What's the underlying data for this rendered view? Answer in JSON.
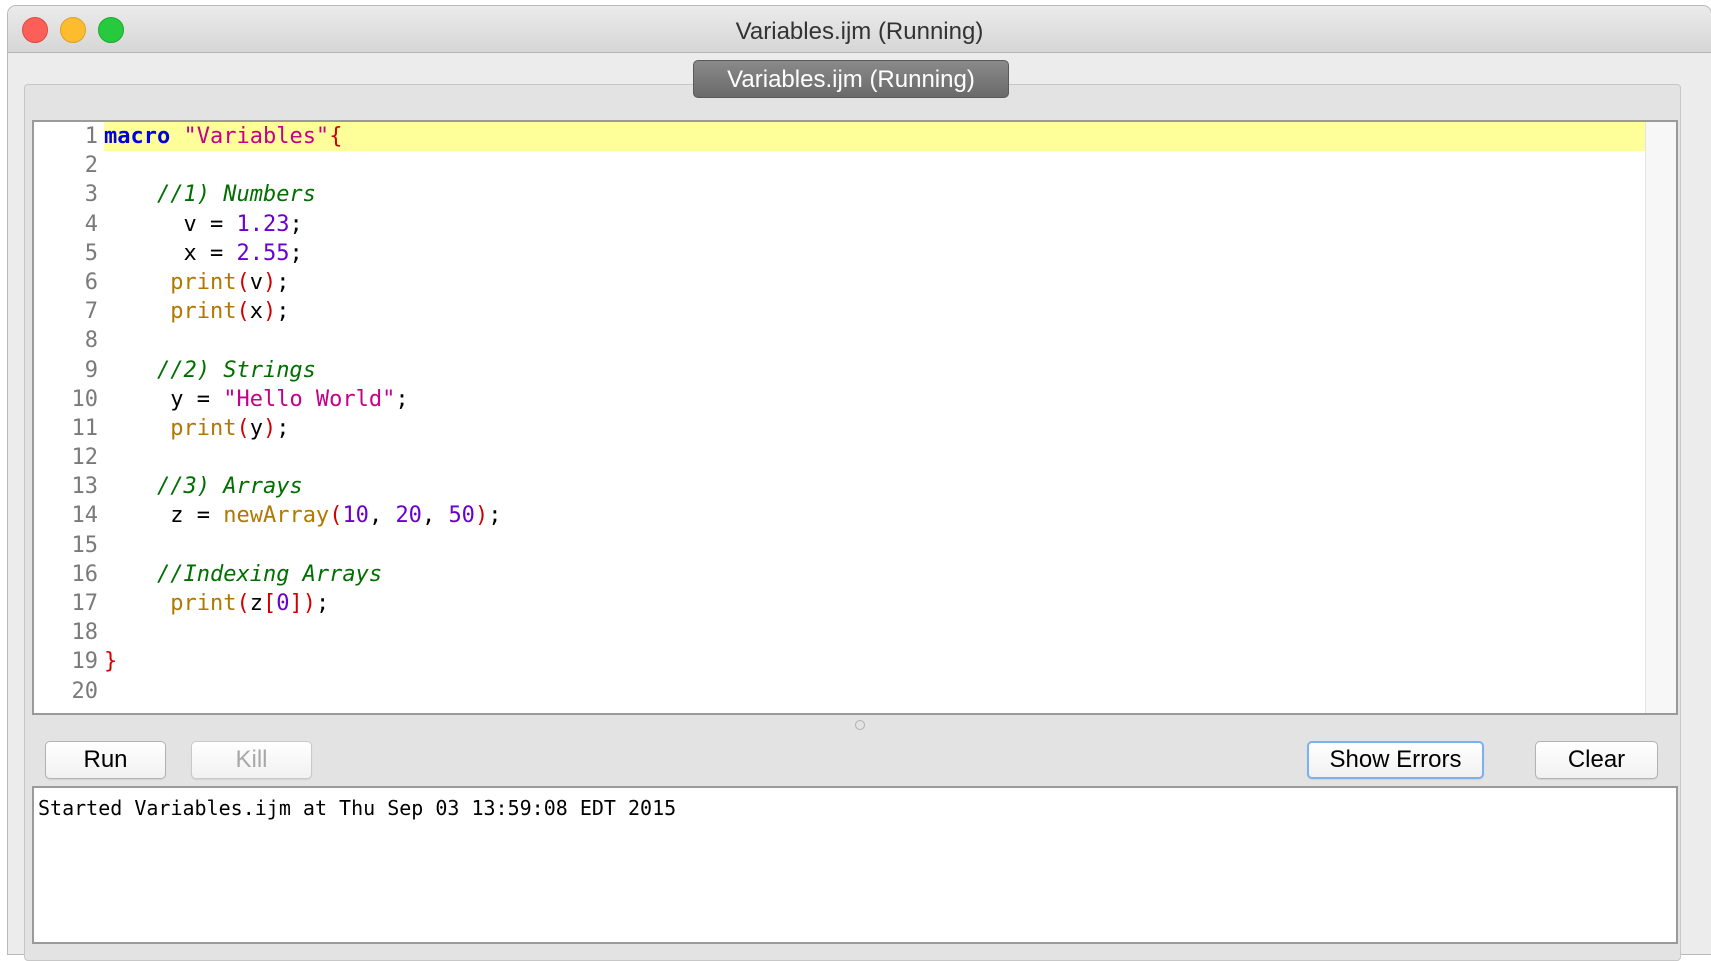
{
  "window": {
    "title": "Variables.ijm (Running)"
  },
  "tab": {
    "label": "Variables.ijm (Running)"
  },
  "editor": {
    "lines": [
      {
        "num": "1",
        "tokens": [
          [
            "kw",
            "macro"
          ],
          [
            "pl",
            " "
          ],
          [
            "str",
            "\"Variables\""
          ],
          [
            "brace",
            "{"
          ]
        ]
      },
      {
        "num": "2",
        "tokens": []
      },
      {
        "num": "3",
        "tokens": [
          [
            "pl",
            "    "
          ],
          [
            "com",
            "//1) Numbers"
          ]
        ]
      },
      {
        "num": "4",
        "tokens": [
          [
            "pl",
            "      v = "
          ],
          [
            "num",
            "1.23"
          ],
          [
            "pl",
            ";"
          ]
        ]
      },
      {
        "num": "5",
        "tokens": [
          [
            "pl",
            "      x = "
          ],
          [
            "num",
            "2.55"
          ],
          [
            "pl",
            ";"
          ]
        ]
      },
      {
        "num": "6",
        "tokens": [
          [
            "pl",
            "     "
          ],
          [
            "fn",
            "print"
          ],
          [
            "par",
            "("
          ],
          [
            "pl",
            "v"
          ],
          [
            "par",
            ")"
          ],
          [
            "pl",
            ";"
          ]
        ]
      },
      {
        "num": "7",
        "tokens": [
          [
            "pl",
            "     "
          ],
          [
            "fn",
            "print"
          ],
          [
            "par",
            "("
          ],
          [
            "pl",
            "x"
          ],
          [
            "par",
            ")"
          ],
          [
            "pl",
            ";"
          ]
        ]
      },
      {
        "num": "8",
        "tokens": []
      },
      {
        "num": "9",
        "tokens": [
          [
            "pl",
            "    "
          ],
          [
            "com",
            "//2) Strings"
          ]
        ]
      },
      {
        "num": "10",
        "tokens": [
          [
            "pl",
            "     y = "
          ],
          [
            "str",
            "\"Hello World\""
          ],
          [
            "pl",
            ";"
          ]
        ]
      },
      {
        "num": "11",
        "tokens": [
          [
            "pl",
            "     "
          ],
          [
            "fn",
            "print"
          ],
          [
            "par",
            "("
          ],
          [
            "pl",
            "y"
          ],
          [
            "par",
            ")"
          ],
          [
            "pl",
            ";"
          ]
        ]
      },
      {
        "num": "12",
        "tokens": []
      },
      {
        "num": "13",
        "tokens": [
          [
            "pl",
            "    "
          ],
          [
            "com",
            "//3) Arrays"
          ]
        ]
      },
      {
        "num": "14",
        "tokens": [
          [
            "pl",
            "     z = "
          ],
          [
            "fn",
            "newArray"
          ],
          [
            "par",
            "("
          ],
          [
            "num",
            "10"
          ],
          [
            "pl",
            ", "
          ],
          [
            "num",
            "20"
          ],
          [
            "pl",
            ", "
          ],
          [
            "num",
            "50"
          ],
          [
            "par",
            ")"
          ],
          [
            "pl",
            ";"
          ]
        ]
      },
      {
        "num": "15",
        "tokens": []
      },
      {
        "num": "16",
        "tokens": [
          [
            "pl",
            "    "
          ],
          [
            "com",
            "//Indexing Arrays"
          ]
        ]
      },
      {
        "num": "17",
        "tokens": [
          [
            "pl",
            "     "
          ],
          [
            "fn",
            "print"
          ],
          [
            "par",
            "("
          ],
          [
            "pl",
            "z"
          ],
          [
            "par",
            "["
          ],
          [
            "num",
            "0"
          ],
          [
            "par",
            "])"
          ],
          [
            "pl",
            ";"
          ]
        ]
      },
      {
        "num": "18",
        "tokens": []
      },
      {
        "num": "19",
        "tokens": [
          [
            "brace",
            "}"
          ]
        ]
      },
      {
        "num": "20",
        "tokens": []
      }
    ],
    "current_line": "1"
  },
  "buttons": {
    "run": "Run",
    "kill": "Kill",
    "show_errors": "Show Errors",
    "clear": "Clear"
  },
  "log": {
    "text": "Started Variables.ijm at Thu Sep 03 13:59:08 EDT 2015"
  },
  "colors": {
    "current_line_bg": "#ffff99",
    "keyword": "#0000e0",
    "string": "#c7008a",
    "comment": "#006e00",
    "number": "#6a00d0",
    "function": "#b07800",
    "paren": "#d00000"
  }
}
